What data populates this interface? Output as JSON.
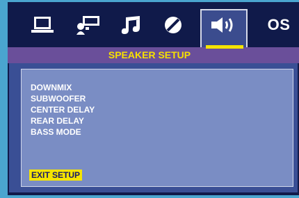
{
  "tabs": [
    {
      "icon": "monitor-icon",
      "label": ""
    },
    {
      "icon": "speaker-audio-icon",
      "label": ""
    },
    {
      "icon": "music-note-icon",
      "label": ""
    },
    {
      "icon": "disc-icon",
      "label": ""
    },
    {
      "icon": "speaker-volume-icon",
      "label": "",
      "active": true
    },
    {
      "icon": "",
      "label": "OS"
    }
  ],
  "section": {
    "title": "SPEAKER  SETUP"
  },
  "menu": {
    "items": [
      "DOWNMIX",
      "SUBWOOFER",
      "CENTER DELAY",
      "REAR DELAY",
      "BASS MODE"
    ],
    "exit_label": "EXIT SETUP"
  },
  "colors": {
    "background": "#4aa5cf",
    "tabbar": "#101a4a",
    "section_bar": "#6a4f9a",
    "highlight": "#f5e400",
    "panel": "#7a8dc4",
    "active_tab": "#3b4c8e"
  }
}
